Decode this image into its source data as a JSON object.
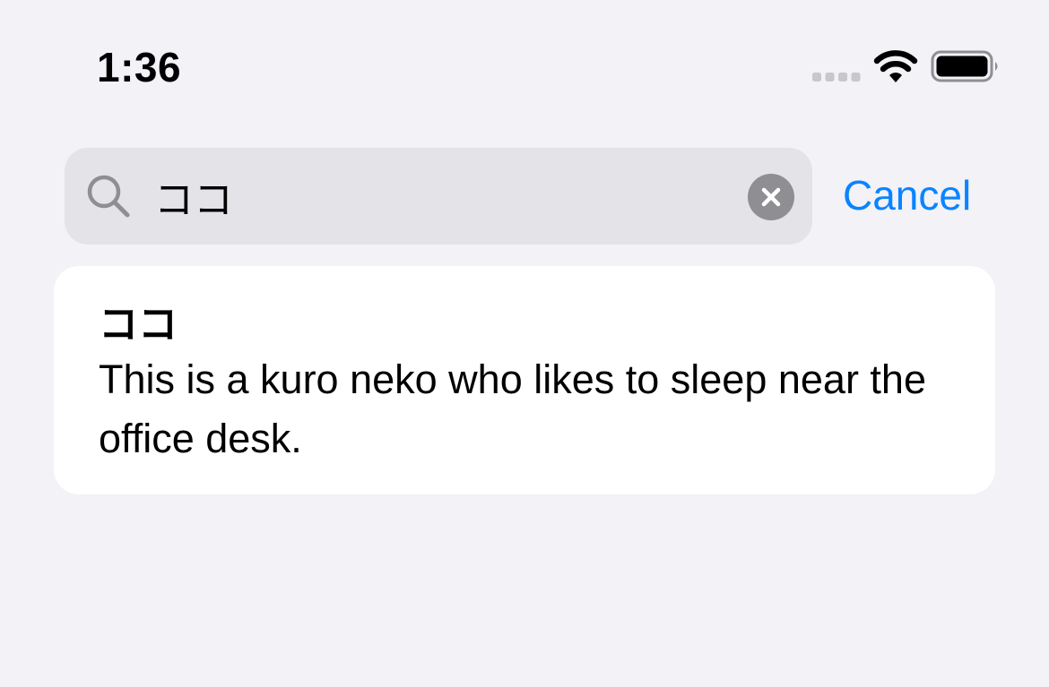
{
  "status_bar": {
    "time": "1:36",
    "icons": [
      "cellular-signal-icon",
      "wifi-icon",
      "battery-icon"
    ]
  },
  "search": {
    "value": "ココ",
    "placeholder": "",
    "icon": "search-icon",
    "clear_icon": "clear-icon",
    "cancel_label": "Cancel"
  },
  "results": [
    {
      "title": "ココ",
      "description": "This is a kuro neko who likes to sleep near the office desk."
    }
  ],
  "colors": {
    "background": "#f2f2f7",
    "search_field": "#e3e3e8",
    "accent": "#0a84ff",
    "card": "#ffffff",
    "secondary_icon": "#8e8e93"
  }
}
